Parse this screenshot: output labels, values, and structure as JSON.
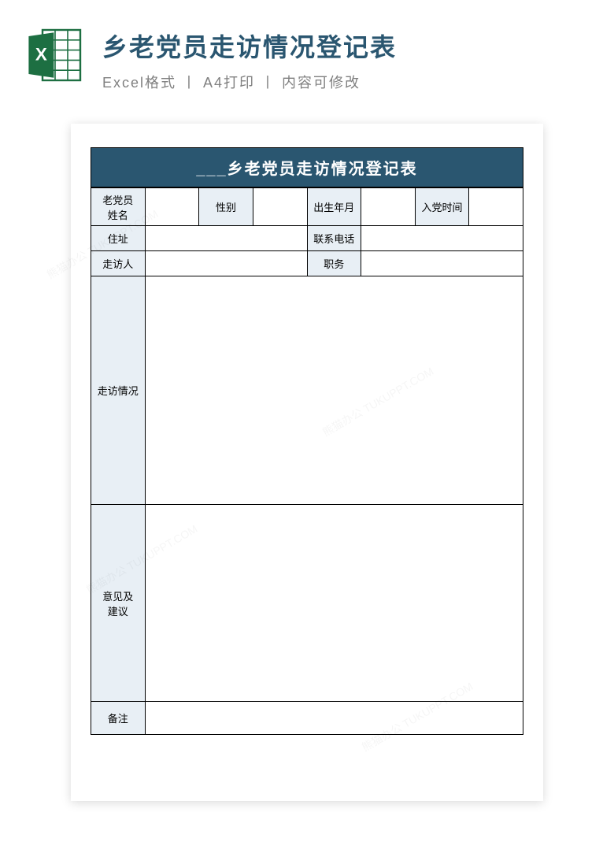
{
  "header": {
    "title": "乡老党员走访情况登记表",
    "subtitle": "Excel格式 丨 A4打印 丨 内容可修改"
  },
  "form": {
    "title": "___乡老党员走访情况登记表",
    "labels": {
      "name": "老党员\n姓名",
      "gender": "性别",
      "birth": "出生年月",
      "join_date": "入党时间",
      "address": "住址",
      "phone": "联系电话",
      "visitor": "走访人",
      "position": "职务",
      "visit_detail": "走访情况",
      "opinion": "意见及\n建议",
      "remark": "备注"
    }
  },
  "watermark": "熊猫办公 TUKUPPT.COM"
}
